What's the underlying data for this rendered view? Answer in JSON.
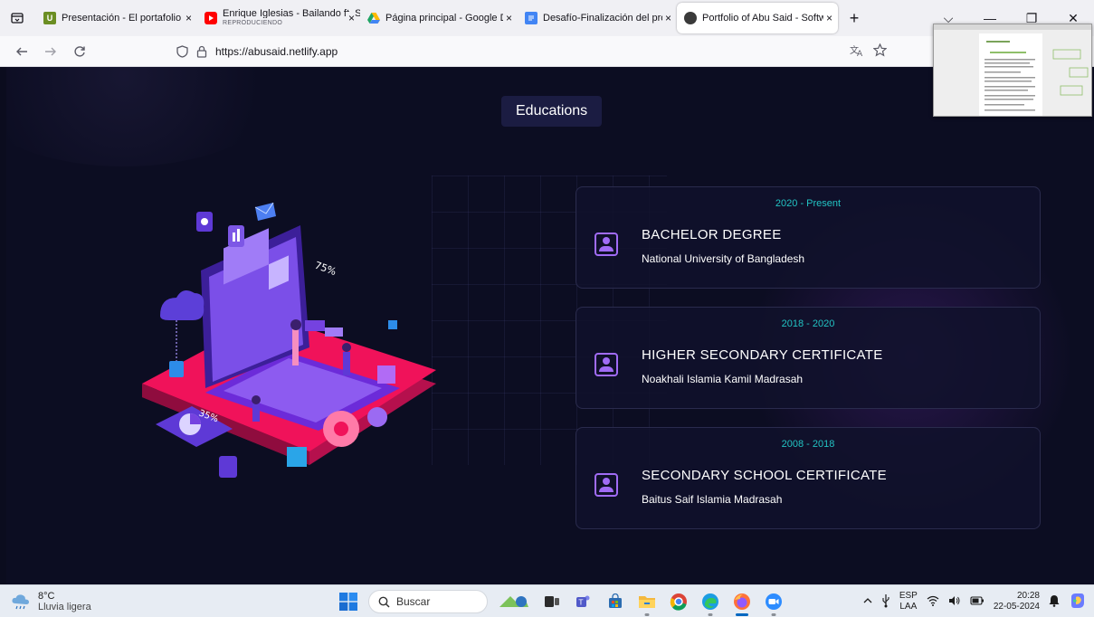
{
  "browser": {
    "tabs": [
      {
        "title": "Presentación - El portafolio de",
        "favicon": "presentation-icon",
        "favicon_color": "#6b8e23"
      },
      {
        "title": "Enrique Iglesias - Bailando ft. Se",
        "subtitle": "REPRODUCIENDO",
        "favicon": "youtube-icon",
        "favicon_color": "#ff0000"
      },
      {
        "title": "Página principal - Google Drive",
        "favicon": "google-drive-icon",
        "favicon_color": "#1fa463"
      },
      {
        "title": "Desafío-Finalización del proyec",
        "favicon": "docs-icon",
        "favicon_color": "#4285f4"
      },
      {
        "title": "Portfolio of Abu Said - Software",
        "favicon": "portfolio-icon",
        "favicon_color": "#333333",
        "active": true
      }
    ],
    "tab_close": "×",
    "new_tab": "+",
    "url": "https://abusaid.netlify.app",
    "window_controls": {
      "list": "⌵",
      "minimize": "—",
      "restore": "❐",
      "close": "✕"
    }
  },
  "page": {
    "section_title": "Educations",
    "education": [
      {
        "period": "2020 - Present",
        "degree": "BACHELOR DEGREE",
        "school": "National University of Bangladesh"
      },
      {
        "period": "2018 - 2020",
        "degree": "HIGHER SECONDARY CERTIFICATE",
        "school": "Noakhali Islamia Kamil Madrasah"
      },
      {
        "period": "2008 - 2018",
        "degree": "SECONDARY SCHOOL CERTIFICATE",
        "school": "Baitus Saif Islamia Madrasah"
      }
    ],
    "illustration": {
      "percent_a": "75%",
      "percent_b": "35%"
    },
    "colors": {
      "accent_teal": "#22c3c3",
      "accent_purple": "#a06bf5",
      "background": "#0c0d22"
    }
  },
  "taskbar": {
    "weather": {
      "temp": "8°C",
      "desc": "Lluvia ligera"
    },
    "search_label": "Buscar",
    "lang_top": "ESP",
    "lang_bottom": "LAA",
    "time": "20:28",
    "date": "22-05-2024"
  }
}
